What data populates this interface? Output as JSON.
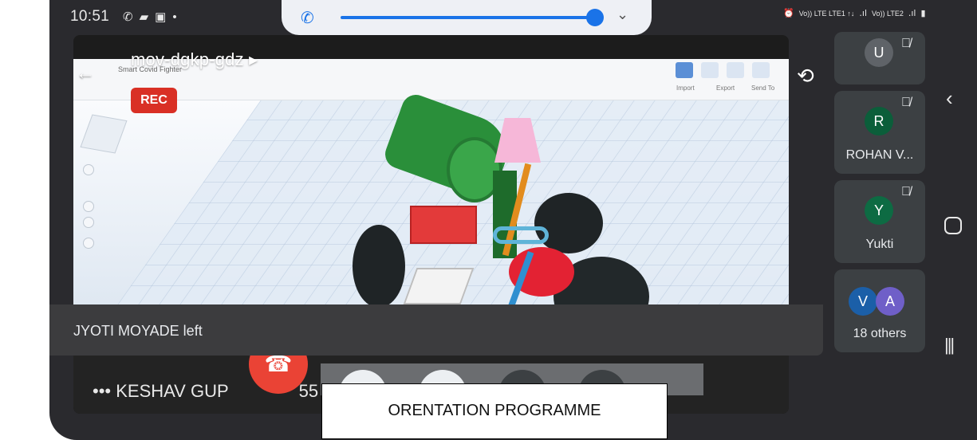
{
  "status_bar": {
    "time": "10:51",
    "left_icons": [
      "whatsapp-icon",
      "message-icon",
      "image-icon",
      "dot-icon"
    ],
    "right_icons": [
      "alarm-icon",
      "volte1-signal-icon",
      "volte2-signal-icon",
      "battery-icon"
    ],
    "carrier1": "Vo)) LTE LTE1 ↑↓",
    "carrier2": "Vo)) LTE2"
  },
  "volume_panel": {
    "level": 0.92,
    "icon": "phone-icon",
    "accent": "#1a73e8"
  },
  "meeting": {
    "code": "mov-dgkp-gdz",
    "code_chevron": "▸",
    "rec_label": "REC",
    "presenter_name": "KESHAV GUP",
    "presenter_suffix": "55",
    "more_icon": "•••"
  },
  "shared_screen": {
    "app_title": "Smart Covid Fighter",
    "toolbar_labels": [
      "Import",
      "Export",
      "Send To"
    ]
  },
  "toast": {
    "message": "JYOTI MOYADE left"
  },
  "overlay_label": {
    "text": "ORENTATION PROGRAMME"
  },
  "participants": [
    {
      "initial": "U",
      "name": "",
      "color": "#5f6368",
      "muted": true
    },
    {
      "initial": "R",
      "name": "ROHAN V...",
      "color": "#0b5e3a",
      "muted": true
    },
    {
      "initial": "Y",
      "name": "Yukti",
      "color": "#0d6b43",
      "muted": true
    }
  ],
  "others": {
    "initials": [
      "V",
      "A"
    ],
    "colors": [
      "#1b5fa8",
      "#6f5fc8"
    ],
    "label": "18 others"
  },
  "colors": {
    "end_call": "#ea4335",
    "rec": "#d93025",
    "tile_bg": "#3c4043"
  }
}
